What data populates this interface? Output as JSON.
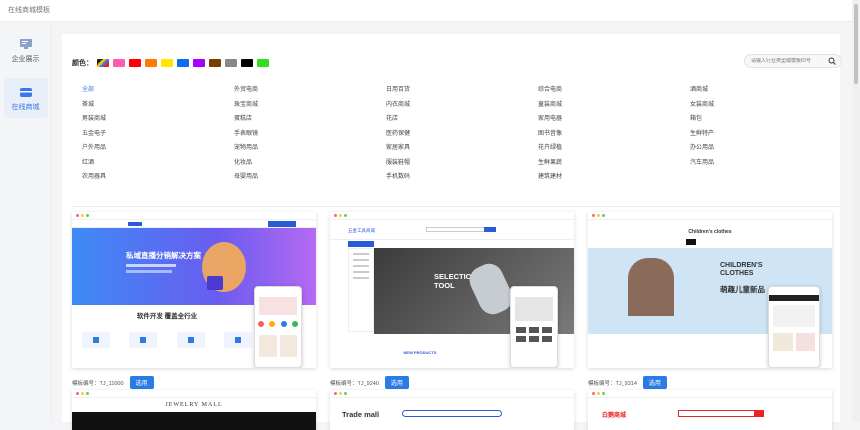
{
  "window": {
    "title": "在线商城模板"
  },
  "sidebar": {
    "items": [
      {
        "label": "企业展示",
        "icon": "monitor-icon"
      },
      {
        "label": "在线商城",
        "icon": "store-icon"
      }
    ]
  },
  "filter": {
    "color_label": "颜色：",
    "colors": [
      "#ff5db1",
      "#fe0000",
      "#ff7a00",
      "#ffe600",
      "#0d6cf2",
      "#a300ff",
      "#7a3e00",
      "#888888",
      "#000000",
      "#33dd22"
    ],
    "search_placeholder": "请输入行业类型或模板ID号"
  },
  "categories": [
    "全部",
    "外贸电商",
    "日用百货",
    "综合电商",
    "酒商城",
    "茶城",
    "珠宝商城",
    "内衣商城",
    "童装商城",
    "女装商城",
    "男装商城",
    "蛋糕店",
    "花店",
    "家用电器",
    "箱包",
    "五金电子",
    "手表眼镜",
    "医药保健",
    "图书音像",
    "生鲜特产",
    "户外用品",
    "宠物用品",
    "家居家具",
    "花卉绿植",
    "办公用品",
    "红酒",
    "化妆品",
    "服装鞋帽",
    "生鲜果蔬",
    "汽车用品",
    "农用器具",
    "母婴用品",
    "手机数码",
    "建筑建材"
  ],
  "templates": [
    {
      "id_label": "模板编号：TJ_11000",
      "button": "选用",
      "hero": "私域直播分销解决方案",
      "section": "软件开发 覆盖全行业"
    },
    {
      "id_label": "模板编号：TJ_9240",
      "button": "选用",
      "hero": "SELECTION TOOL",
      "brand": "五金工具商城",
      "section": "NEW PRODUCTS"
    },
    {
      "id_label": "模板编号：TJ_9314",
      "button": "选用",
      "brand": "Children's clothes",
      "hero": "CHILDREN'S CLOTHES",
      "sub": "萌趣儿童新品"
    },
    {
      "brand": "JEWELRY MALL"
    },
    {
      "brand": "Trade mall"
    },
    {
      "brand": "白鹅商城"
    }
  ]
}
